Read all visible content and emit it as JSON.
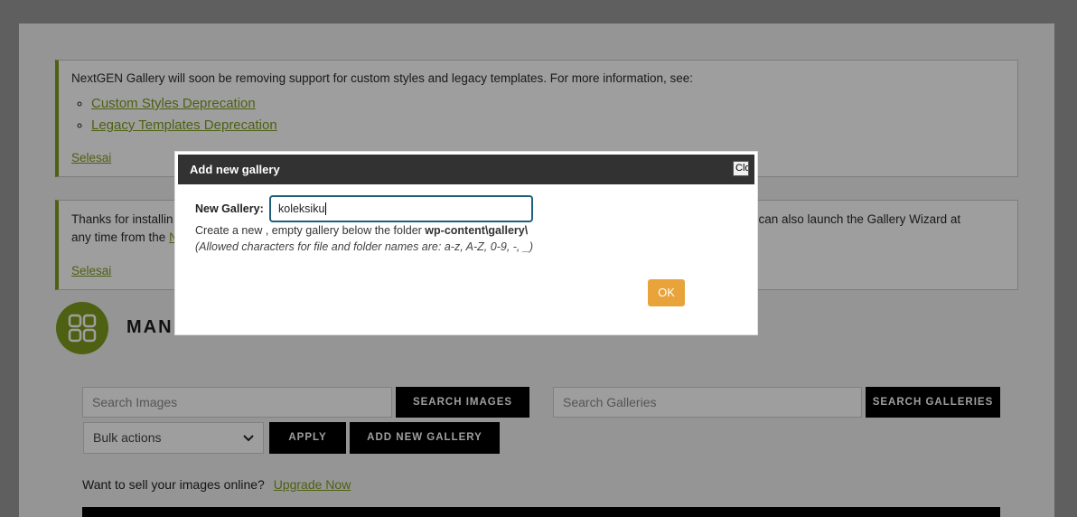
{
  "notice_deprecation": {
    "message": "NextGEN Gallery will soon be removing support for custom styles and legacy templates. For more information, see:",
    "links": [
      "Custom Styles Deprecation",
      "Legacy Templates Deprecation"
    ],
    "dismiss": "Selesai"
  },
  "notice_install": {
    "message_start": "Thanks for installin",
    "message_line2_start": "any time from the",
    "link_fragment": "N",
    "message_right": "e, you can also launch the Gallery Wizard at",
    "dismiss": "Selesai"
  },
  "page": {
    "title_fragment": "MAN"
  },
  "toolbar": {
    "search_images_placeholder": "Search Images",
    "search_images_button": "SEARCH IMAGES",
    "search_galleries_placeholder": "Search Galleries",
    "search_galleries_button": "SEARCH GALLERIES",
    "bulk_actions": "Bulk actions",
    "apply_button": "APPLY",
    "add_new_gallery_button": "ADD NEW GALLERY"
  },
  "sell": {
    "text": "Want to sell your images online?",
    "link": "Upgrade Now"
  },
  "dialog": {
    "title": "Add new gallery",
    "close_label": "Close",
    "field_label": "New Gallery:",
    "input_value": "koleksiku",
    "help_prefix": "Create a new , empty gallery below the folder ",
    "help_folder": "wp-content\\gallery\\",
    "help_allowed": "(Allowed characters for file and folder names are: a-z, A-Z, 0-9, -, _)",
    "ok_button": "OK"
  },
  "colors": {
    "accent_green": "#7e9b1e",
    "ok_orange": "#e8a33a",
    "dialog_header": "#323232"
  }
}
